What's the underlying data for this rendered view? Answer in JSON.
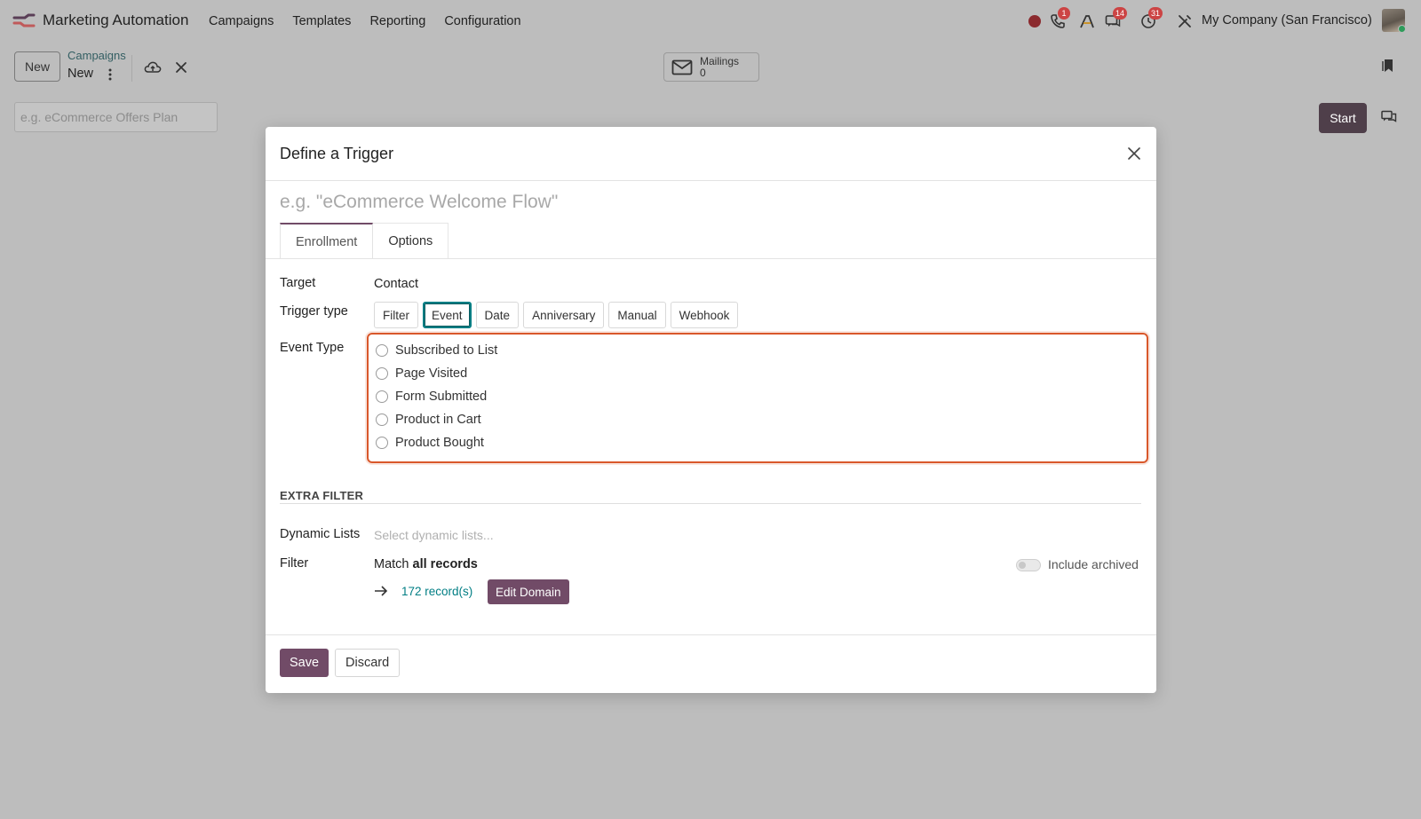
{
  "app": {
    "name": "Marketing Automation"
  },
  "menu": [
    "Campaigns",
    "Templates",
    "Reporting",
    "Configuration"
  ],
  "systray": {
    "phone_badge": "1",
    "messages_badge": "14",
    "activities_badge": "31",
    "company": "My Company (San Francisco)"
  },
  "control_panel": {
    "new_label": "New",
    "breadcrumb_parent": "Campaigns",
    "breadcrumb_current": "New",
    "mailings_label": "Mailings",
    "mailings_count": "0",
    "plan_placeholder": "e.g. eCommerce Offers Plan",
    "start_label": "Start"
  },
  "dialog": {
    "title": "Define a Trigger",
    "name_placeholder": "e.g. \"eCommerce Welcome Flow\"",
    "tabs": [
      "Enrollment",
      "Options"
    ],
    "target_label": "Target",
    "target_value": "Contact",
    "trigger_type_label": "Trigger type",
    "trigger_types": [
      "Filter",
      "Event",
      "Date",
      "Anniversary",
      "Manual",
      "Webhook"
    ],
    "selected_trigger_type": "Event",
    "event_type_label": "Event Type",
    "event_types": [
      "Subscribed to List",
      "Page Visited",
      "Form Submitted",
      "Product in Cart",
      "Product Bought"
    ],
    "extra_filter_title": "EXTRA FILTER",
    "dynamic_lists_label": "Dynamic Lists",
    "dynamic_lists_placeholder": "Select dynamic lists...",
    "filter_label": "Filter",
    "match_prefix": "Match",
    "match_bold": "all records",
    "include_archived_label": "Include archived",
    "records_link": "172 record(s)",
    "edit_domain_label": "Edit Domain",
    "save_label": "Save",
    "discard_label": "Discard"
  },
  "colors": {
    "brand": "#714b67",
    "accent_teal": "#017e84",
    "highlight": "#d9582b"
  }
}
